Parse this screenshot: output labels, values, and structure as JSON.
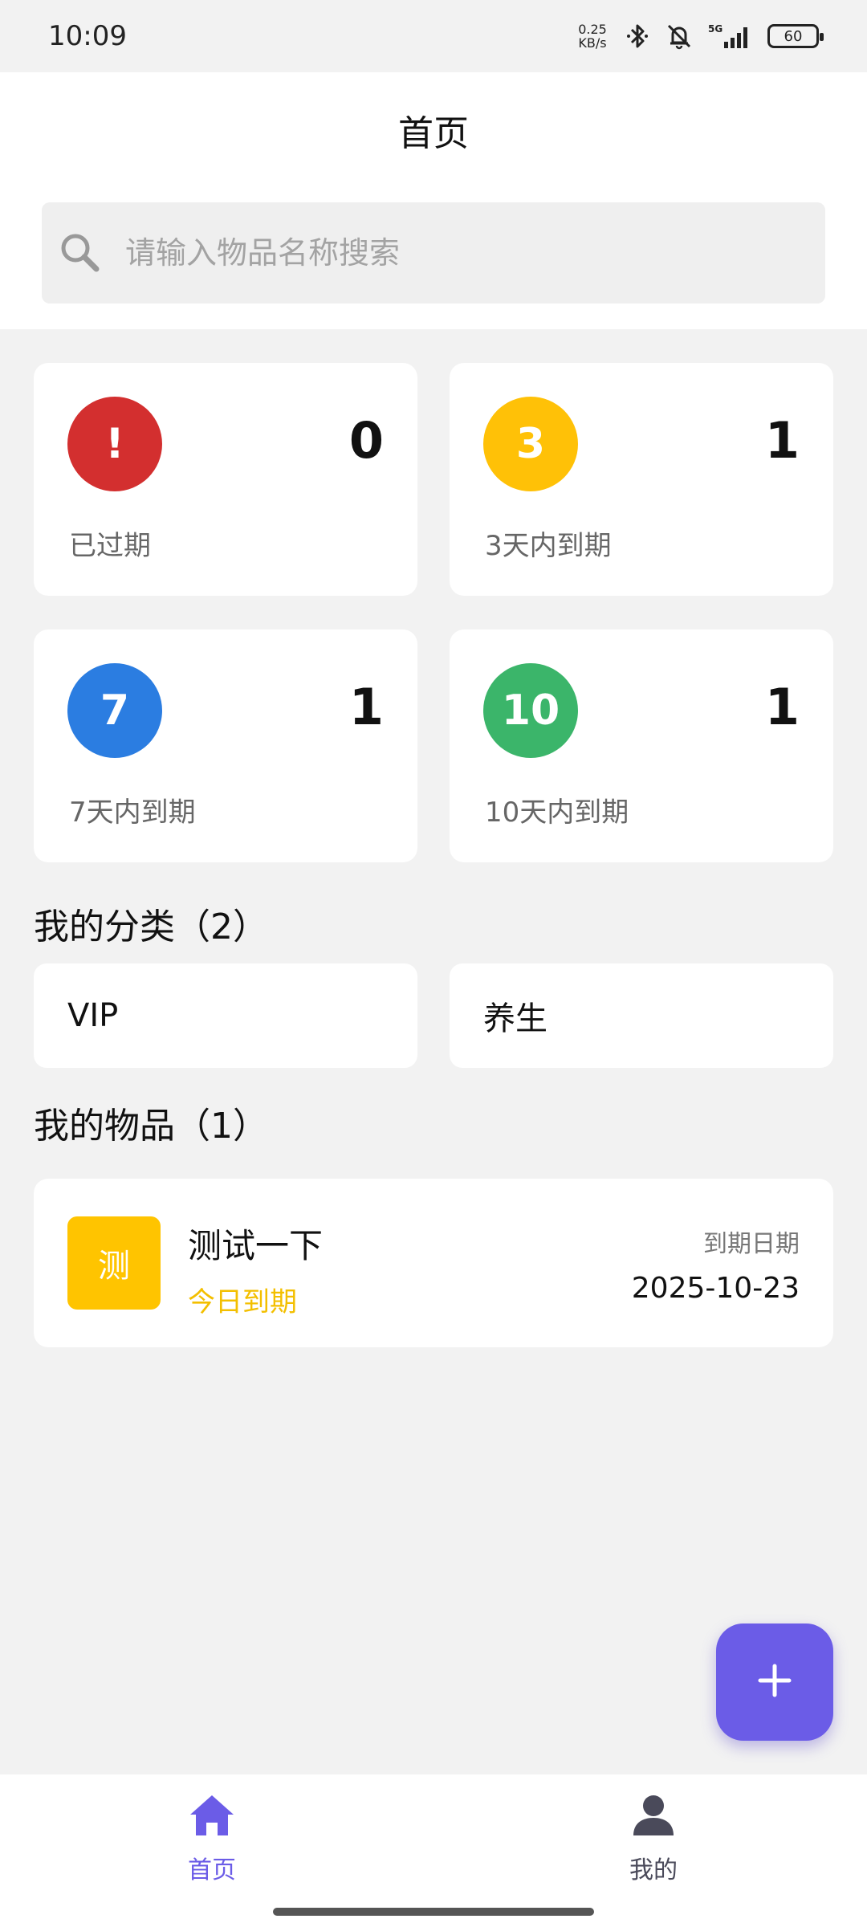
{
  "status_bar": {
    "time": "10:09",
    "net_speed_value": "0.25",
    "net_speed_unit": "KB/s",
    "network": "5G",
    "battery": "60"
  },
  "header": {
    "title": "首页",
    "search_placeholder": "请输入物品名称搜索"
  },
  "stats": [
    {
      "badge": "!",
      "count": "0",
      "label": "已过期",
      "color": "#d32f2f"
    },
    {
      "badge": "3",
      "count": "1",
      "label": "3天内到期",
      "color": "#ffc107"
    },
    {
      "badge": "7",
      "count": "1",
      "label": "7天内到期",
      "color": "#2b7de1"
    },
    {
      "badge": "10",
      "count": "1",
      "label": "10天内到期",
      "color": "#3bb56a"
    }
  ],
  "categories": {
    "title": "我的分类（2）",
    "items": [
      "VIP",
      "养生"
    ]
  },
  "items_section": {
    "title": "我的物品（1）",
    "items": [
      {
        "thumb": "测",
        "name": "测试一下",
        "status": "今日到期",
        "date_label": "到期日期",
        "date": "2025-10-23"
      }
    ]
  },
  "bottom_nav": {
    "home_label": "首页",
    "mine_label": "我的",
    "active_color": "#6b5ce7",
    "inactive_color": "#4a4a5a"
  }
}
